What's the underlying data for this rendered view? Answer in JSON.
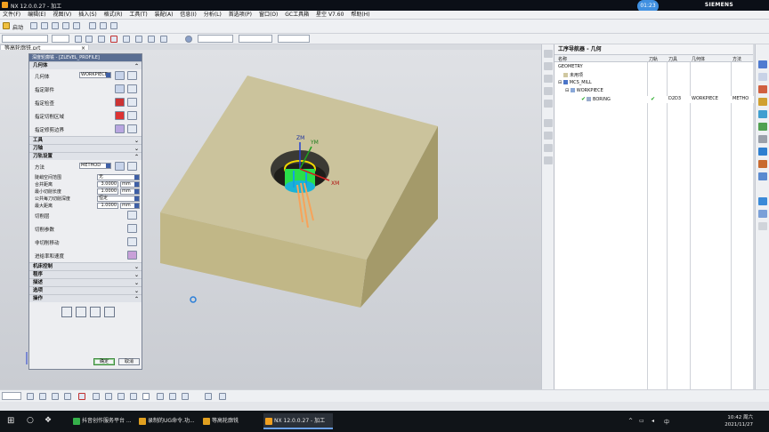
{
  "window": {
    "title": "NX 12.0.0.27 - 加工",
    "time_badge": "01:23",
    "brand": "SIEMENS"
  },
  "menubar": {
    "items": [
      "文件(F)",
      "编辑(E)",
      "视图(V)",
      "插入(S)",
      "格式(R)",
      "工具(T)",
      "装配(A)",
      "信息(I)",
      "分析(L)",
      "首选项(P)",
      "窗口(O)",
      "GC工具箱",
      "星空 V7.60",
      "帮助(H)"
    ]
  },
  "toolbar": {
    "start_label": "启动"
  },
  "document_tab": {
    "label": "等高轮廓铣.prt",
    "close": "×"
  },
  "dialog": {
    "title": "深度轮廓铣 - [ZLEVEL_PROFILE]",
    "sections": {
      "geometry": "几何体",
      "tool": "工具",
      "tool_axis": "刀轴",
      "tool_path_settings": "刀轨设置",
      "machine_control": "机床控制",
      "program": "程序",
      "description": "描述",
      "options": "选项",
      "actions": "操作"
    },
    "geometry": {
      "label": "几何体",
      "value": "WORKPIECE",
      "specify_part": "指定部件",
      "specify_check": "指定检查",
      "specify_cut_area": "指定切削区域",
      "specify_trim_boundary": "指定修剪边界"
    },
    "path": {
      "method_label": "方法",
      "method_value": "METHOD",
      "steep_label": "陡峭空间范围",
      "steep_value": "无",
      "merge_label": "合并距离",
      "merge_value": "3.0000",
      "min_cut_label": "最小切削长度",
      "min_cut_value": "1.0000",
      "depth_label": "公共每刀切削深度",
      "depth_value": "恒定",
      "max_dist_label": "最大距离",
      "max_dist_value": "1.0000",
      "unit": "mm",
      "cut_levels": "切削层",
      "cut_params": "切削参数",
      "non_cut_moves": "非切削移动",
      "feeds_speeds": "进给率和速度"
    },
    "ok": "确定",
    "cancel": "取消"
  },
  "viewport": {
    "axes": [
      "ZM",
      "YM",
      "XM"
    ]
  },
  "navigator": {
    "title": "工序导航器 - 几何",
    "columns": [
      "名称",
      "刀轨",
      "刀具",
      "几何体",
      "方法"
    ],
    "rows": [
      {
        "name": "GEOMETRY",
        "path": "",
        "tool": "",
        "geometry": "",
        "method": ""
      },
      {
        "name": "未用项",
        "path": "",
        "tool": "",
        "geometry": "",
        "method": ""
      },
      {
        "name": "MCS_MILL",
        "path": "",
        "tool": "",
        "geometry": "",
        "method": ""
      },
      {
        "name": "WORKPIECE",
        "path": "",
        "tool": "",
        "geometry": "",
        "method": ""
      },
      {
        "name": "BORING",
        "path": "✔",
        "tool": "D2D3",
        "geometry": "WORKPIECE",
        "method": "METHO"
      }
    ]
  },
  "taskbar": {
    "tasks": [
      "抖音创作服务平台 ...",
      "录制的UG命令.功...",
      "等高轮廓铣",
      "NX 12.0.0.27 - 加工"
    ],
    "time": "10:42 周六",
    "date": "2021/11/27"
  },
  "colors": {
    "block_top": "#cbc39c",
    "block_right": "#a49a6a",
    "block_front": "#c1b787",
    "ok_green": "#22a822"
  }
}
